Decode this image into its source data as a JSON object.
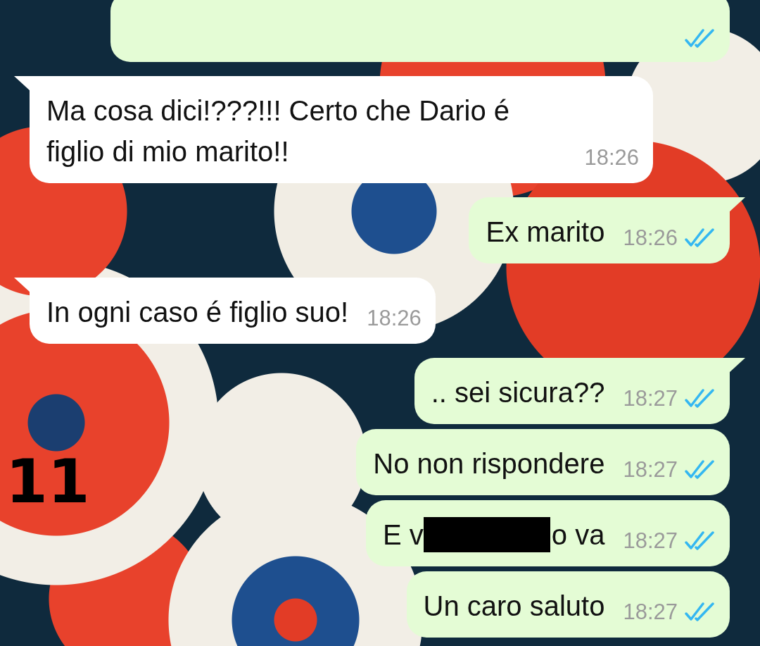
{
  "annotation": "11",
  "messages": [
    {
      "kind": "clipped",
      "outgoing": true,
      "tail": false,
      "read": true
    },
    {
      "kind": "text",
      "outgoing": false,
      "tail": true,
      "text": "Ma cosa dici!???!!! Certo che Dario é figlio di mio marito!!",
      "time": "18:26"
    },
    {
      "kind": "text",
      "outgoing": true,
      "tail": true,
      "text": "Ex marito",
      "time": "18:26",
      "read": true
    },
    {
      "kind": "text",
      "outgoing": false,
      "tail": true,
      "text": "In ogni caso é figlio suo!",
      "time": "18:26"
    },
    {
      "kind": "text",
      "outgoing": true,
      "tail": true,
      "text": ".. sei sicura??",
      "time": "18:27",
      "read": true
    },
    {
      "kind": "text",
      "outgoing": true,
      "tail": false,
      "text": "No non rispondere",
      "time": "18:27",
      "read": true
    },
    {
      "kind": "redacted",
      "outgoing": true,
      "tail": false,
      "before": "E v",
      "after": "o va",
      "time": "18:27",
      "read": true
    },
    {
      "kind": "text",
      "outgoing": true,
      "tail": false,
      "text": "Un caro saluto",
      "time": "18:27",
      "read": true
    }
  ]
}
